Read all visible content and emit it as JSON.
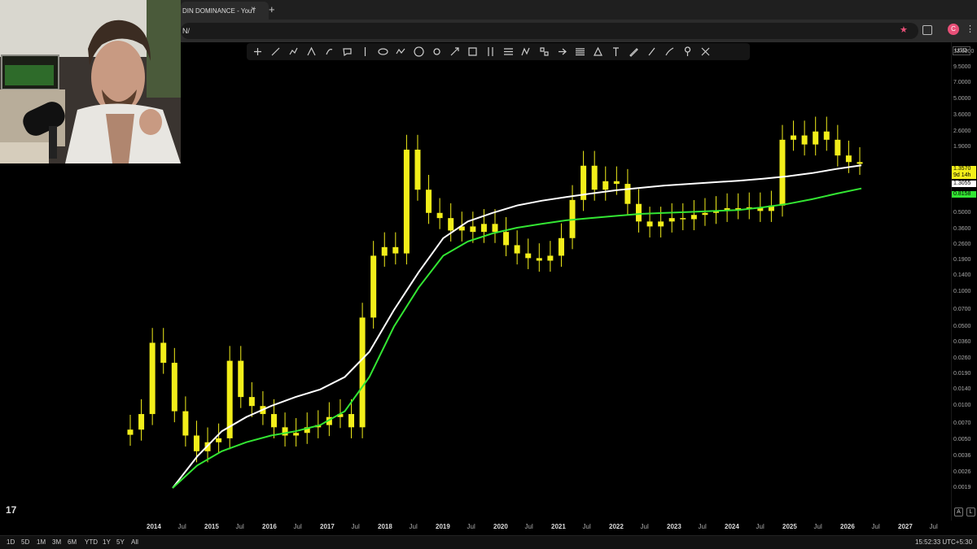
{
  "browser": {
    "tab_title": "DIN DOMINANCE - YouT",
    "tab_close_glyph": "×",
    "newtab_glyph": "+",
    "url_text": "N/",
    "profile_letter": "C",
    "kebab_glyph": "⋮",
    "star_glyph": "★"
  },
  "toolbar": {
    "tools": [
      "crosshair-icon",
      "trend-line-icon",
      "multi-line-icon",
      "pitchfork-icon",
      "brush-icon",
      "callout-icon",
      "vertical-line-icon",
      "ellipse-icon",
      "path-icon",
      "circle-tool-icon",
      "target-icon",
      "arrow-icon",
      "rectangle-icon",
      "vertical-ruler-icon",
      "fib-channel-icon",
      "pattern-icon",
      "position-icon",
      "arrow-marker-icon",
      "lines-icon",
      "triangle-icon",
      "text-icon",
      "pencil-icon",
      "highlighter-icon",
      "brush-tool-icon",
      "pin-icon",
      "measure-icon"
    ]
  },
  "price_axis": {
    "currency": "USD",
    "labels": [
      "13.0000",
      "9.5000",
      "7.0000",
      "5.0000",
      "3.6000",
      "2.6000",
      "1.9000",
      "1.3570",
      "9d 14h",
      "1.3055",
      "0.8158",
      "0.7000",
      "0.5000",
      "0.3600",
      "0.2600",
      "0.1900",
      "0.1400",
      "0.1000",
      "0.0700",
      "0.0500",
      "0.0360",
      "0.0260",
      "0.0190",
      "0.0140",
      "0.0100",
      "0.0070",
      "0.0050",
      "0.0036",
      "0.0026",
      "0.0019"
    ],
    "badge_price": "1.3570",
    "badge_countdown": "9d 14h",
    "badge_white": "1.3055",
    "badge_green": "0.8158",
    "colors": {
      "candle": "#f2ee1a",
      "white_ma": "#ffffff",
      "green_ma": "#33e633",
      "badge_white": "#ffffff",
      "badge_green": "#33e633"
    }
  },
  "time_axis": {
    "labels": [
      "2014",
      "Jul",
      "2015",
      "Jul",
      "2016",
      "Jul",
      "2017",
      "Jul",
      "2018",
      "Jul",
      "2019",
      "Jul",
      "2020",
      "Jul",
      "2021",
      "Jul",
      "2022",
      "Jul",
      "2023",
      "Jul",
      "2024",
      "Jul",
      "2025",
      "Jul",
      "2026",
      "Jul",
      "2027",
      "Jul"
    ]
  },
  "bottombar": {
    "ranges": [
      "1D",
      "5D",
      "1M",
      "3M",
      "6M",
      "YTD",
      "1Y",
      "5Y",
      "All"
    ],
    "clock": "15:52:33 UTC+5:30"
  },
  "chart_area": {
    "logo": "17",
    "scale_buttons": [
      "A",
      "L"
    ]
  },
  "chart_data": {
    "type": "candlestick",
    "scale": "log",
    "series": [
      {
        "name": "",
        "candle_closes": [
          0.0062,
          0.0085,
          0.036,
          0.024,
          0.009,
          0.0055,
          0.004,
          0.0048,
          0.0052,
          0.025,
          0.012,
          0.01,
          0.0085,
          0.0065,
          0.0055,
          0.0058,
          0.0065,
          0.0068,
          0.008,
          0.0085,
          0.0065,
          0.06,
          0.21,
          0.25,
          0.22,
          1.8,
          0.8,
          0.5,
          0.45,
          0.35,
          0.38,
          0.34,
          0.4,
          0.34,
          0.26,
          0.22,
          0.2,
          0.19,
          0.21,
          0.3,
          0.65,
          1.3,
          0.8,
          0.95,
          0.9,
          0.6,
          0.42,
          0.38,
          0.42,
          0.45,
          0.44,
          0.48,
          0.5,
          0.52,
          0.55,
          0.55,
          0.56,
          0.52,
          0.58,
          2.2,
          2.4,
          2.0,
          2.6,
          2.2,
          1.6,
          1.4,
          1.35
        ]
      }
    ]
  }
}
